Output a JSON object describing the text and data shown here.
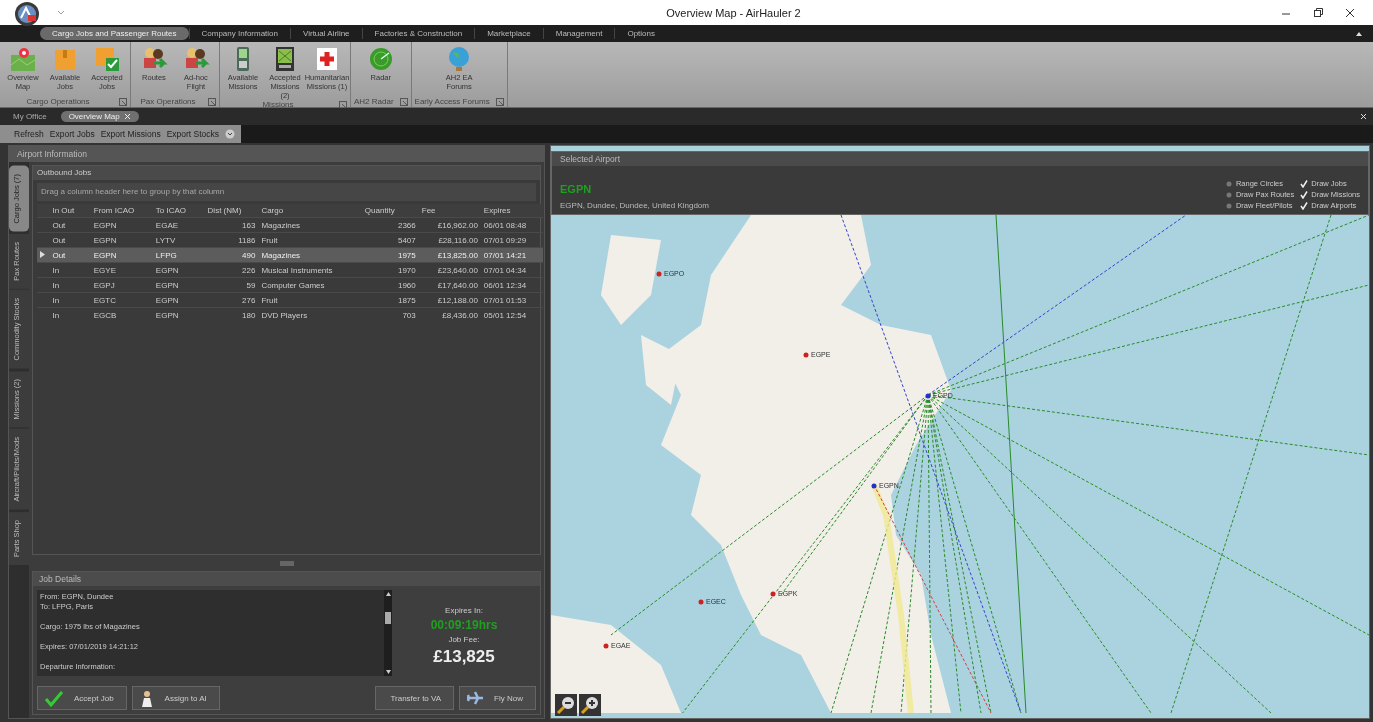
{
  "window": {
    "title": "Overview Map - AirHauler 2"
  },
  "ribbon_tabs": [
    {
      "label": "Cargo Jobs and Passenger Routes",
      "selected": true
    },
    {
      "label": "Company Information",
      "selected": false
    },
    {
      "label": "Virtual Airline",
      "selected": false
    },
    {
      "label": "Factories & Construction",
      "selected": false
    },
    {
      "label": "Marketplace",
      "selected": false
    },
    {
      "label": "Management",
      "selected": false
    },
    {
      "label": "Options",
      "selected": false
    }
  ],
  "ribbon_groups": [
    {
      "title": "Cargo Operations",
      "buttons": [
        {
          "label": "Overview Map",
          "kind": "map"
        },
        {
          "label": "Available Jobs",
          "kind": "box"
        },
        {
          "label": "Accepted Jobs",
          "kind": "boxcheck"
        }
      ]
    },
    {
      "title": "Pax Operations",
      "buttons": [
        {
          "label": "Routes",
          "kind": "people"
        },
        {
          "label": "Ad-hoc Flight",
          "kind": "people"
        }
      ]
    },
    {
      "title": "Missions",
      "buttons": [
        {
          "label": "Available Missions",
          "kind": "phone"
        },
        {
          "label": "Accepted Missions (2)",
          "kind": "chart"
        },
        {
          "label": "Humanitarian Missions (1)",
          "kind": "cross"
        }
      ]
    },
    {
      "title": "AH2 Radar",
      "buttons": [
        {
          "label": "Radar",
          "kind": "radar"
        }
      ]
    },
    {
      "title": "Early Access Forums",
      "buttons": [
        {
          "label": "AH2 EA Forums",
          "kind": "globe"
        }
      ]
    }
  ],
  "doc_tabs": [
    {
      "label": "My Office",
      "selected": false,
      "closable": false
    },
    {
      "label": "Overview Map",
      "selected": true,
      "closable": true
    }
  ],
  "toolbar": [
    "Refresh",
    "Export Jobs",
    "Export Missions",
    "Export Stocks"
  ],
  "airport_panel": {
    "title": "Airport Information",
    "side_tabs": [
      {
        "label": "Cargo Jobs (7)",
        "selected": true
      },
      {
        "label": "Pax Routes",
        "selected": false
      },
      {
        "label": "Commodity Stocks",
        "selected": false
      },
      {
        "label": "Missions (2)",
        "selected": false
      },
      {
        "label": "Aircraft/Pilots/Mods",
        "selected": false
      },
      {
        "label": "Parts Shop",
        "selected": false
      }
    ],
    "jobs_title": "Outbound Jobs",
    "group_hint": "Drag a column header here to group by that column",
    "columns": [
      "In Out",
      "From ICAO",
      "To ICAO",
      "Dist (NM)",
      "Cargo",
      "Quantity",
      "Fee",
      "Expires"
    ],
    "rows": [
      {
        "selected": false,
        "cells": [
          "Out",
          "EGPN",
          "EGAE",
          "163",
          "Magazines",
          "2366",
          "£16,962.00",
          "06/01 08:48"
        ]
      },
      {
        "selected": false,
        "cells": [
          "Out",
          "EGPN",
          "LYTV",
          "1186",
          "Fruit",
          "5407",
          "£28,116.00",
          "07/01 09:29"
        ]
      },
      {
        "selected": true,
        "cells": [
          "Out",
          "EGPN",
          "LFPG",
          "490",
          "Magazines",
          "1975",
          "£13,825.00",
          "07/01 14:21"
        ]
      },
      {
        "selected": false,
        "cells": [
          "In",
          "EGYE",
          "EGPN",
          "226",
          "Musical Instruments",
          "1970",
          "£23,640.00",
          "07/01 04:34"
        ]
      },
      {
        "selected": false,
        "cells": [
          "In",
          "EGPJ",
          "EGPN",
          "59",
          "Computer Games",
          "1960",
          "£17,640.00",
          "06/01 12:34"
        ]
      },
      {
        "selected": false,
        "cells": [
          "In",
          "EGTC",
          "EGPN",
          "276",
          "Fruit",
          "1875",
          "£12,188.00",
          "07/01 01:53"
        ]
      },
      {
        "selected": false,
        "cells": [
          "In",
          "EGCB",
          "EGPN",
          "180",
          "DVD Players",
          "703",
          "£8,436.00",
          "05/01 12:54"
        ]
      }
    ]
  },
  "job_details": {
    "title": "Job Details",
    "paragraphs": [
      [
        "From: EGPN, Dundee",
        "To: LFPG, Paris"
      ],
      [
        "Cargo: 1975 lbs of Magazines"
      ],
      [
        "Expires: 07/01/2019 14:21:12"
      ],
      [
        "Departure Information:"
      ]
    ],
    "expires_label": "Expires In:",
    "expires_value": "00:09:19hrs",
    "fee_label": "Job Fee:",
    "fee_value": "£13,825",
    "buttons": [
      {
        "label": "Accept Job",
        "kind": "check"
      },
      {
        "label": "Assign to AI",
        "kind": "person"
      },
      {
        "label": "Transfer to VA",
        "kind": "plain"
      },
      {
        "label": "Fly Now",
        "kind": "plane"
      }
    ]
  },
  "selected_airport": {
    "title": "Selected Airport",
    "code": "EGPN",
    "name": "EGPN, Dundee, Dundee, United Kingdom",
    "options": [
      {
        "label": "Range Circles",
        "checked": false
      },
      {
        "label": "Draw Jobs",
        "checked": true
      },
      {
        "label": "Draw Pax Routes",
        "checked": false
      },
      {
        "label": "Draw Missions",
        "checked": true
      },
      {
        "label": "Draw Fleet/Pilots",
        "checked": false
      },
      {
        "label": "Draw Airports",
        "checked": true
      }
    ]
  },
  "map": {
    "airports": [
      {
        "code": "EGPO",
        "hub": false
      },
      {
        "code": "EGPE",
        "hub": false
      },
      {
        "code": "EGPD",
        "hub": true
      },
      {
        "code": "EGPN",
        "hub": true
      },
      {
        "code": "EGPK",
        "hub": false
      },
      {
        "code": "EGEC",
        "hub": false
      },
      {
        "code": "EGAE",
        "hub": false
      }
    ]
  }
}
